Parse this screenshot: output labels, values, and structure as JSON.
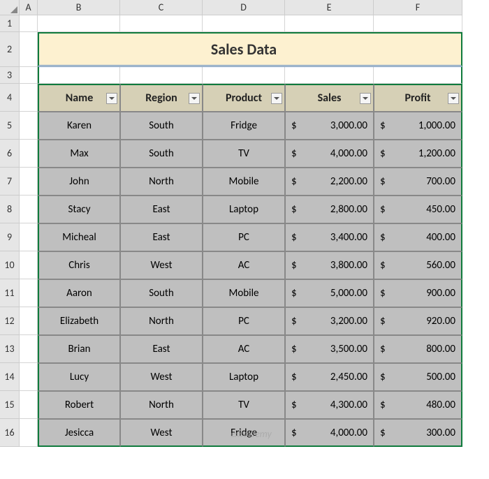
{
  "columns": [
    "A",
    "B",
    "C",
    "D",
    "E",
    "F"
  ],
  "row_numbers": [
    "1",
    "2",
    "3",
    "4",
    "5",
    "6",
    "7",
    "8",
    "9",
    "10",
    "11",
    "12",
    "13",
    "14",
    "15",
    "16"
  ],
  "title": "Sales Data",
  "headers": [
    "Name",
    "Region",
    "Product",
    "Sales",
    "Profit"
  ],
  "rows": [
    {
      "name": "Karen",
      "region": "South",
      "product": "Fridge",
      "sales": "3,000.00",
      "profit": "1,000.00"
    },
    {
      "name": "Max",
      "region": "South",
      "product": "TV",
      "sales": "4,000.00",
      "profit": "1,200.00"
    },
    {
      "name": "John",
      "region": "North",
      "product": "Mobile",
      "sales": "2,200.00",
      "profit": "700.00"
    },
    {
      "name": "Stacy",
      "region": "East",
      "product": "Laptop",
      "sales": "2,800.00",
      "profit": "450.00"
    },
    {
      "name": "Micheal",
      "region": "East",
      "product": "PC",
      "sales": "3,400.00",
      "profit": "400.00"
    },
    {
      "name": "Chris",
      "region": "West",
      "product": "AC",
      "sales": "3,800.00",
      "profit": "560.00"
    },
    {
      "name": "Aaron",
      "region": "South",
      "product": "Mobile",
      "sales": "5,000.00",
      "profit": "900.00"
    },
    {
      "name": "Elizabeth",
      "region": "North",
      "product": "PC",
      "sales": "3,200.00",
      "profit": "920.00"
    },
    {
      "name": "Brian",
      "region": "East",
      "product": "AC",
      "sales": "3,500.00",
      "profit": "800.00"
    },
    {
      "name": "Lucy",
      "region": "West",
      "product": "Laptop",
      "sales": "2,450.00",
      "profit": "500.00"
    },
    {
      "name": "Robert",
      "region": "North",
      "product": "TV",
      "sales": "4,300.00",
      "profit": "480.00"
    },
    {
      "name": "Jesicca",
      "region": "West",
      "product": "Fridge",
      "sales": "4,000.00",
      "profit": "300.00"
    }
  ],
  "currency": "$",
  "watermark": "exceldemy"
}
